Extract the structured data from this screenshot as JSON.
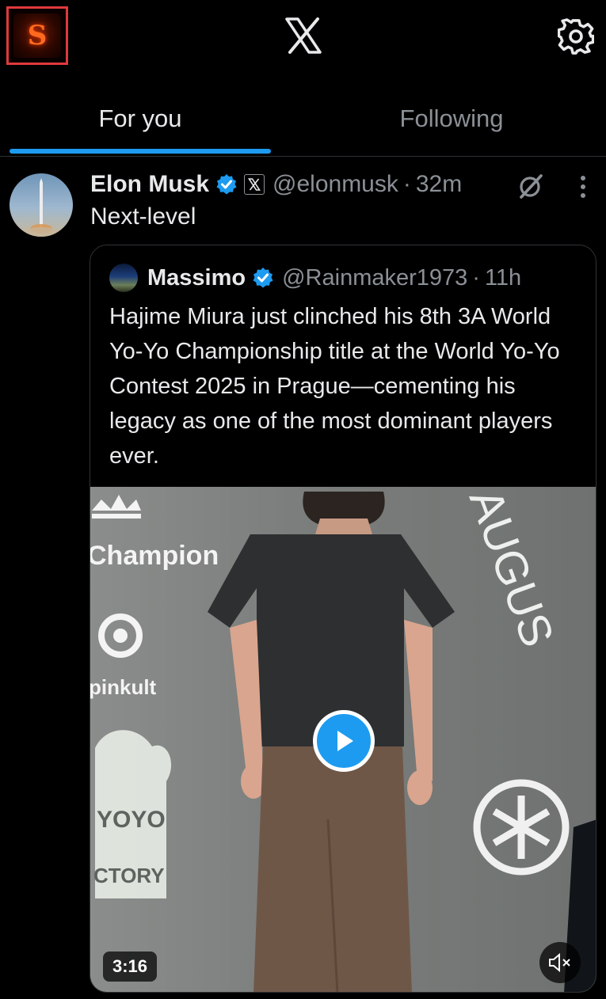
{
  "topbar": {
    "profile_initial": "S",
    "logo_icon": "x-logo-icon",
    "settings_icon": "gear-icon"
  },
  "tabs": [
    {
      "label": "For you",
      "active": true
    },
    {
      "label": "Following",
      "active": false
    }
  ],
  "colors": {
    "accent": "#1d9bf0",
    "muted": "#8b9096",
    "text": "#e7e9ea",
    "background": "#000000"
  },
  "post": {
    "author": "Elon Musk",
    "handle": "@elonmusk",
    "separator": "·",
    "time": "32m",
    "text": "Next-level",
    "affiliate_badge": "X",
    "quote": {
      "author": "Massimo",
      "handle": "@Rainmaker1973",
      "separator": "·",
      "time": "11h",
      "text": "Hajime Miura just clinched his 8th 3A World Yo-Yo Championship title at the World Yo-Yo Contest 2025 in Prague—cementing his legacy as one of the most dominant players ever.",
      "video": {
        "duration": "3:16",
        "backdrop_text": {
          "champion": "Champion",
          "pinkult": "pinkult",
          "augus": "AUGUS",
          "yoyo": "YOYO",
          "ctory": "CTORY"
        }
      }
    }
  }
}
